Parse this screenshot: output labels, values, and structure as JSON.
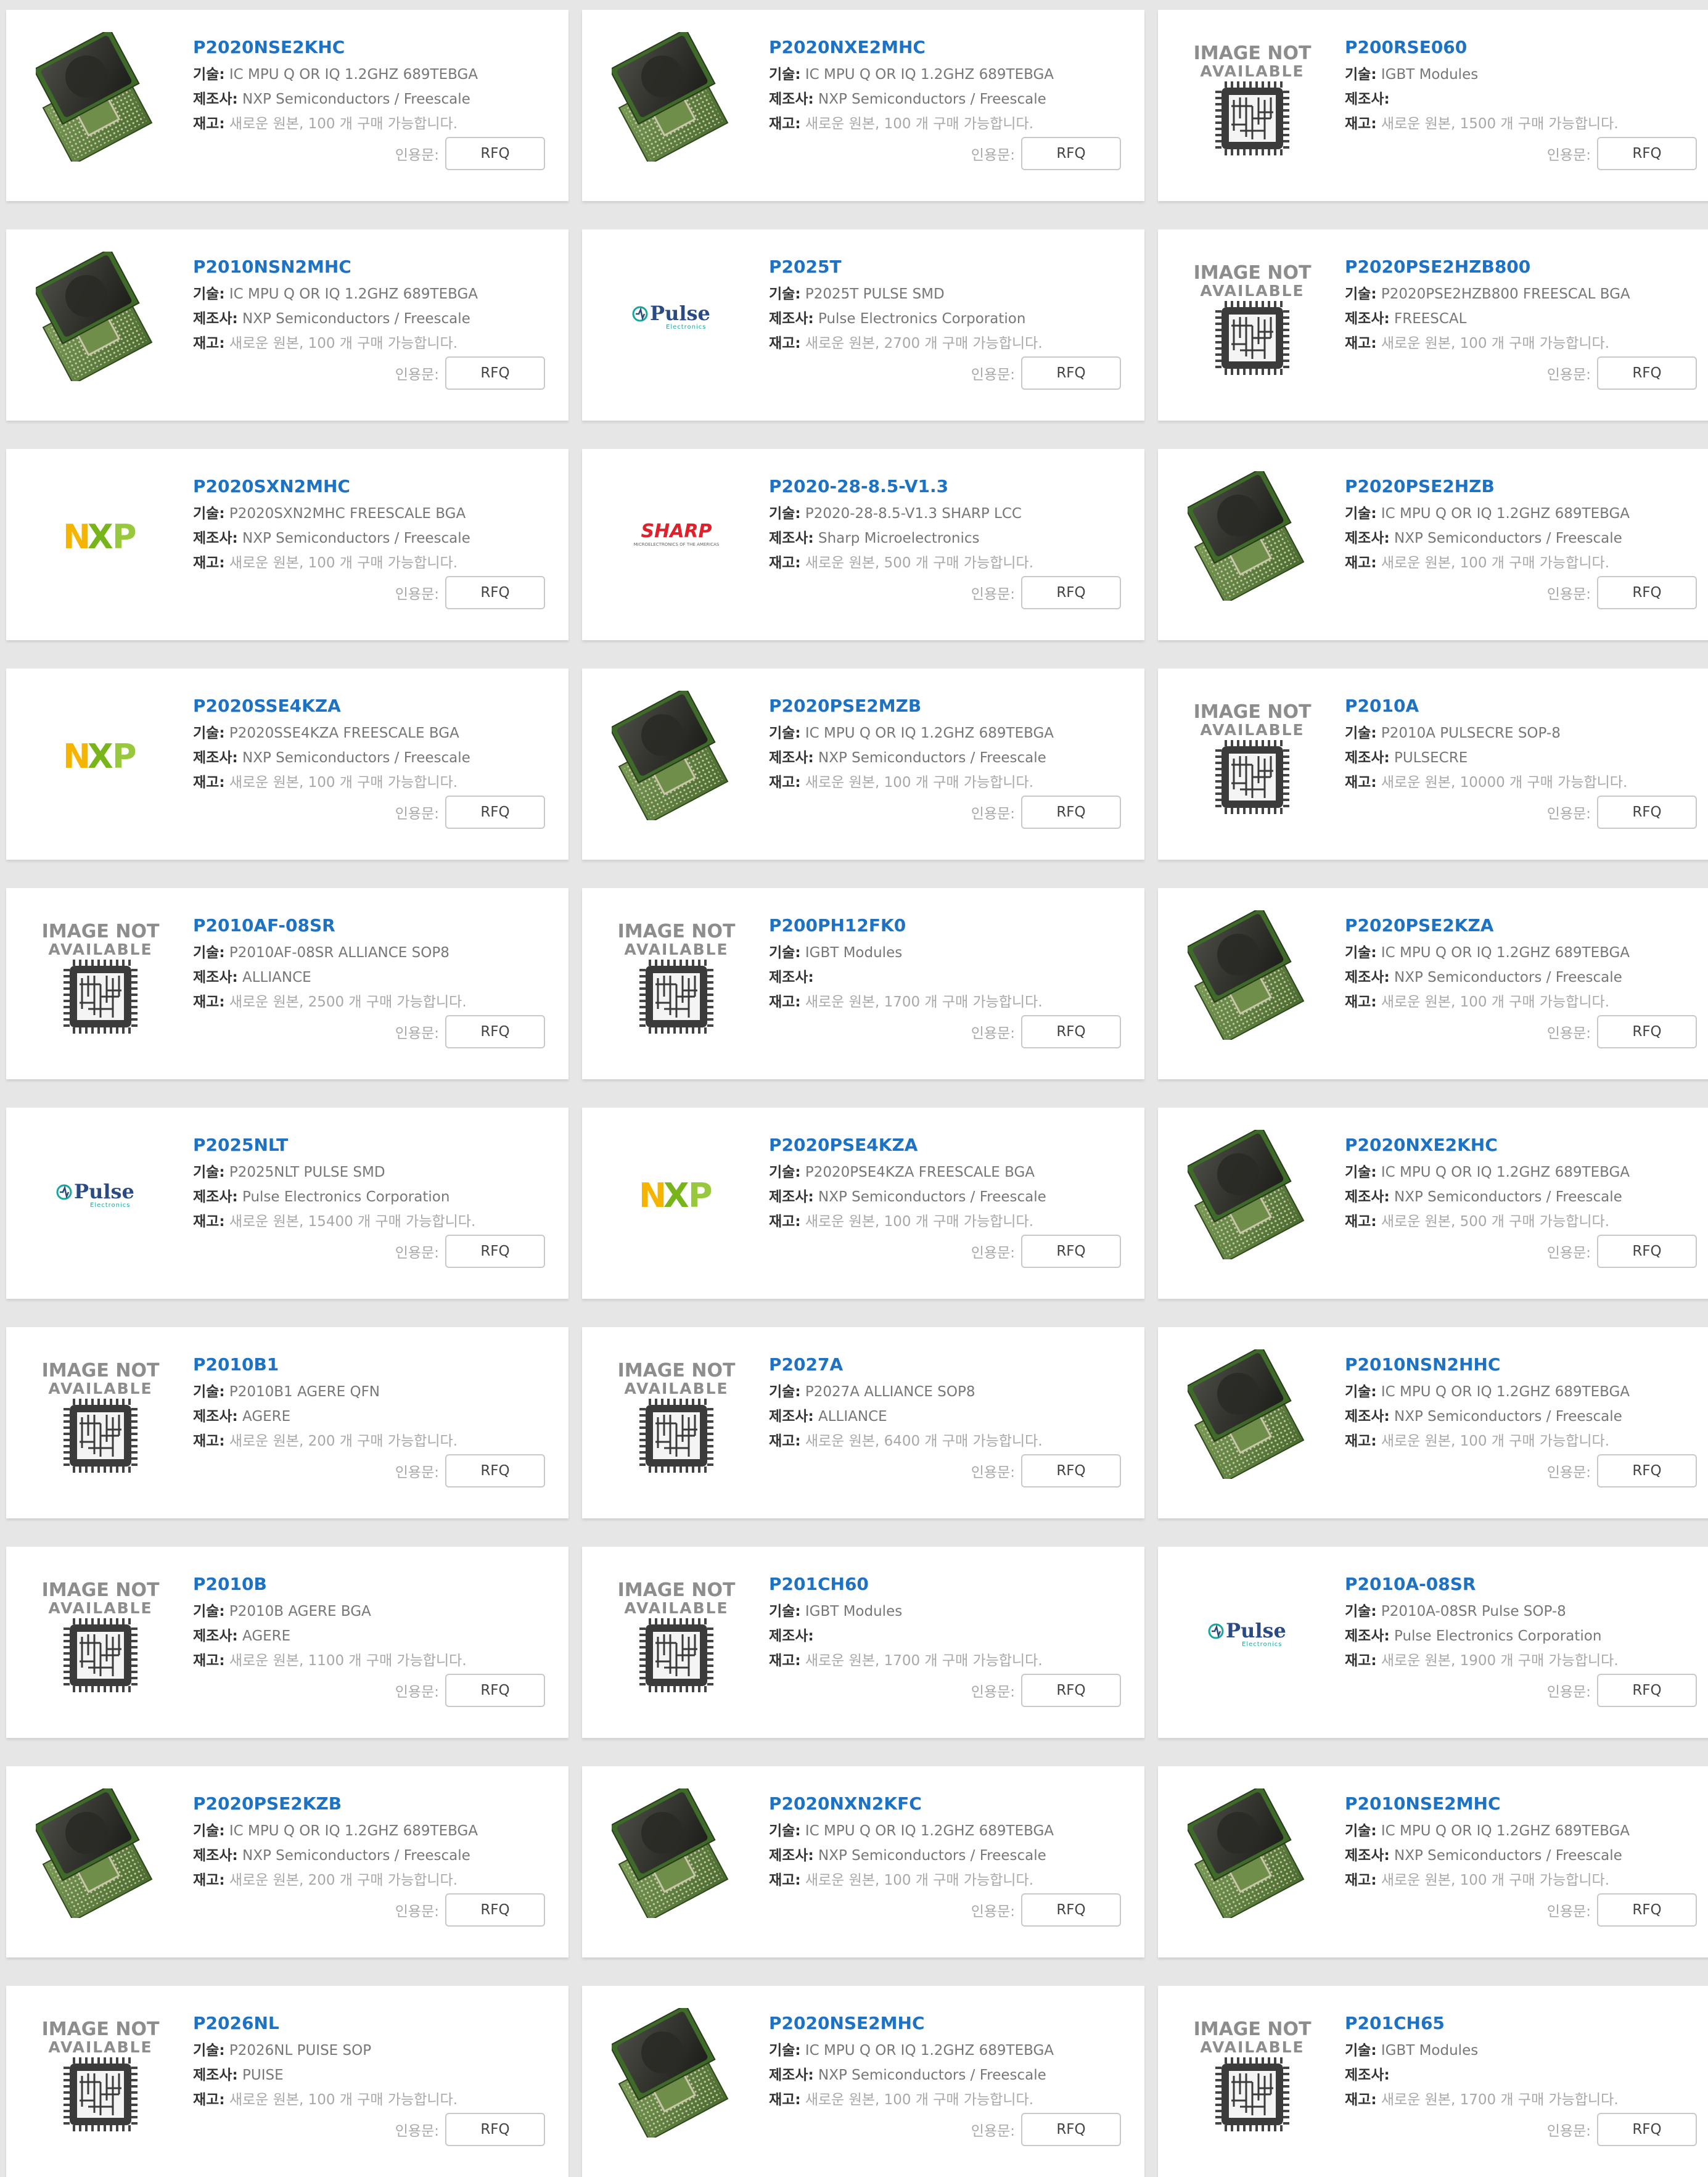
{
  "labels": {
    "tech": "기술:",
    "mfr": "제조사:",
    "stock": "재고:",
    "quote": "인용문:",
    "rfq": "RFQ",
    "image_not_available_line1": "IMAGE NOT",
    "image_not_available_line2": "AVAILABLE"
  },
  "logos": {
    "nxp": "NXP",
    "pulse": "Pulse",
    "pulse_sub": "Electronics",
    "sharp": "SHARP",
    "sharp_sub": "MICROELECTRONICS OF THE AMERICAS"
  },
  "colors": {
    "part_number": "#1d72c4",
    "nxp_n": "#f5b400",
    "nxp_x": "#78b51a",
    "nxp_p": "#98c93c",
    "pulse": "#2a4a84",
    "pulse_accent": "#1aa6a0",
    "sharp": "#e0202b"
  },
  "products": [
    {
      "part": "P2020NSE2KHC",
      "tech": "IC MPU Q OR IQ 1.2GHZ 689TEBGA",
      "mfr": "NXP Semiconductors / Freescale",
      "stock": "새로운 원본, 100 개 구매 가능합니다.",
      "image": "chip"
    },
    {
      "part": "P2020NXE2MHC",
      "tech": "IC MPU Q OR IQ 1.2GHZ 689TEBGA",
      "mfr": "NXP Semiconductors / Freescale",
      "stock": "새로운 원본, 100 개 구매 가능합니다.",
      "image": "chip"
    },
    {
      "part": "P200RSE060",
      "tech": "IGBT Modules",
      "mfr": "",
      "stock": "새로운 원본, 1500 개 구매 가능합니다.",
      "image": "na"
    },
    {
      "part": "P2010NSN2MHC",
      "tech": "IC MPU Q OR IQ 1.2GHZ 689TEBGA",
      "mfr": "NXP Semiconductors / Freescale",
      "stock": "새로운 원본, 100 개 구매 가능합니다.",
      "image": "chip"
    },
    {
      "part": "P2025T",
      "tech": "P2025T PULSE SMD",
      "mfr": "Pulse Electronics Corporation",
      "stock": "새로운 원본, 2700 개 구매 가능합니다.",
      "image": "pulse"
    },
    {
      "part": "P2020PSE2HZB800",
      "tech": "P2020PSE2HZB800 FREESCAL BGA",
      "mfr": "FREESCAL",
      "stock": "새로운 원본, 100 개 구매 가능합니다.",
      "image": "na"
    },
    {
      "part": "P2020SXN2MHC",
      "tech": "P2020SXN2MHC FREESCALE BGA",
      "mfr": "NXP Semiconductors / Freescale",
      "stock": "새로운 원본, 100 개 구매 가능합니다.",
      "image": "nxp"
    },
    {
      "part": "P2020-28-8.5-V1.3",
      "tech": "P2020-28-8.5-V1.3 SHARP LCC",
      "mfr": "Sharp Microelectronics",
      "stock": "새로운 원본, 500 개 구매 가능합니다.",
      "image": "sharp"
    },
    {
      "part": "P2020PSE2HZB",
      "tech": "IC MPU Q OR IQ 1.2GHZ 689TEBGA",
      "mfr": "NXP Semiconductors / Freescale",
      "stock": "새로운 원본, 100 개 구매 가능합니다.",
      "image": "chip"
    },
    {
      "part": "P2020SSE4KZA",
      "tech": "P2020SSE4KZA FREESCALE BGA",
      "mfr": "NXP Semiconductors / Freescale",
      "stock": "새로운 원본, 100 개 구매 가능합니다.",
      "image": "nxp"
    },
    {
      "part": "P2020PSE2MZB",
      "tech": "IC MPU Q OR IQ 1.2GHZ 689TEBGA",
      "mfr": "NXP Semiconductors / Freescale",
      "stock": "새로운 원본, 100 개 구매 가능합니다.",
      "image": "chip"
    },
    {
      "part": "P2010A",
      "tech": "P2010A PULSECRE SOP-8",
      "mfr": "PULSECRE",
      "stock": "새로운 원본, 10000 개 구매 가능합니다.",
      "image": "na"
    },
    {
      "part": "P2010AF-08SR",
      "tech": "P2010AF-08SR ALLIANCE SOP8",
      "mfr": "ALLIANCE",
      "stock": "새로운 원본, 2500 개 구매 가능합니다.",
      "image": "na"
    },
    {
      "part": "P200PH12FK0",
      "tech": "IGBT Modules",
      "mfr": "",
      "stock": "새로운 원본, 1700 개 구매 가능합니다.",
      "image": "na"
    },
    {
      "part": "P2020PSE2KZA",
      "tech": "IC MPU Q OR IQ 1.2GHZ 689TEBGA",
      "mfr": "NXP Semiconductors / Freescale",
      "stock": "새로운 원본, 100 개 구매 가능합니다.",
      "image": "chip"
    },
    {
      "part": "P2025NLT",
      "tech": "P2025NLT PULSE SMD",
      "mfr": "Pulse Electronics Corporation",
      "stock": "새로운 원본, 15400 개 구매 가능합니다.",
      "image": "pulse"
    },
    {
      "part": "P2020PSE4KZA",
      "tech": "P2020PSE4KZA FREESCALE BGA",
      "mfr": "NXP Semiconductors / Freescale",
      "stock": "새로운 원본, 100 개 구매 가능합니다.",
      "image": "nxp"
    },
    {
      "part": "P2020NXE2KHC",
      "tech": "IC MPU Q OR IQ 1.2GHZ 689TEBGA",
      "mfr": "NXP Semiconductors / Freescale",
      "stock": "새로운 원본, 500 개 구매 가능합니다.",
      "image": "chip"
    },
    {
      "part": "P2010B1",
      "tech": "P2010B1 AGERE QFN",
      "mfr": "AGERE",
      "stock": "새로운 원본, 200 개 구매 가능합니다.",
      "image": "na"
    },
    {
      "part": "P2027A",
      "tech": "P2027A ALLIANCE SOP8",
      "mfr": "ALLIANCE",
      "stock": "새로운 원본, 6400 개 구매 가능합니다.",
      "image": "na"
    },
    {
      "part": "P2010NSN2HHC",
      "tech": "IC MPU Q OR IQ 1.2GHZ 689TEBGA",
      "mfr": "NXP Semiconductors / Freescale",
      "stock": "새로운 원본, 100 개 구매 가능합니다.",
      "image": "chip"
    },
    {
      "part": "P2010B",
      "tech": "P2010B AGERE BGA",
      "mfr": "AGERE",
      "stock": "새로운 원본, 1100 개 구매 가능합니다.",
      "image": "na"
    },
    {
      "part": "P201CH60",
      "tech": "IGBT Modules",
      "mfr": "",
      "stock": "새로운 원본, 1700 개 구매 가능합니다.",
      "image": "na"
    },
    {
      "part": "P2010A-08SR",
      "tech": "P2010A-08SR Pulse SOP-8",
      "mfr": "Pulse Electronics Corporation",
      "stock": "새로운 원본, 1900 개 구매 가능합니다.",
      "image": "pulse"
    },
    {
      "part": "P2020PSE2KZB",
      "tech": "IC MPU Q OR IQ 1.2GHZ 689TEBGA",
      "mfr": "NXP Semiconductors / Freescale",
      "stock": "새로운 원본, 200 개 구매 가능합니다.",
      "image": "chip"
    },
    {
      "part": "P2020NXN2KFC",
      "tech": "IC MPU Q OR IQ 1.2GHZ 689TEBGA",
      "mfr": "NXP Semiconductors / Freescale",
      "stock": "새로운 원본, 100 개 구매 가능합니다.",
      "image": "chip"
    },
    {
      "part": "P2010NSE2MHC",
      "tech": "IC MPU Q OR IQ 1.2GHZ 689TEBGA",
      "mfr": "NXP Semiconductors / Freescale",
      "stock": "새로운 원본, 100 개 구매 가능합니다.",
      "image": "chip"
    },
    {
      "part": "P2026NL",
      "tech": "P2026NL PUISE SOP",
      "mfr": "PUISE",
      "stock": "새로운 원본, 100 개 구매 가능합니다.",
      "image": "na"
    },
    {
      "part": "P2020NSE2MHC",
      "tech": "IC MPU Q OR IQ 1.2GHZ 689TEBGA",
      "mfr": "NXP Semiconductors / Freescale",
      "stock": "새로운 원본, 100 개 구매 가능합니다.",
      "image": "chip"
    },
    {
      "part": "P201CH65",
      "tech": "IGBT Modules",
      "mfr": "",
      "stock": "새로운 원본, 1700 개 구매 가능합니다.",
      "image": "na"
    }
  ]
}
